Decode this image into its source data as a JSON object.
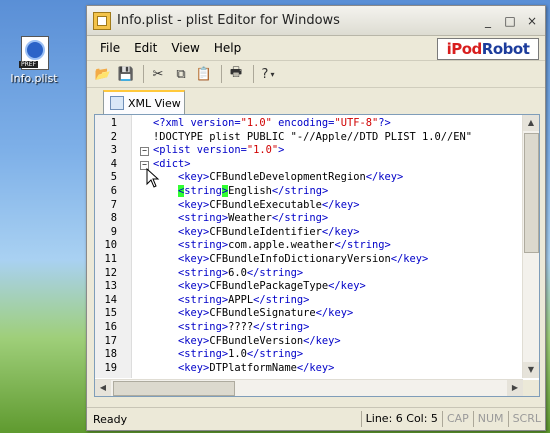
{
  "desktop": {
    "icon_label": "Info.plist",
    "icon_tag": "PREF"
  },
  "window": {
    "title": "Info.plist - plist Editor for Windows",
    "controls": {
      "minimize": "_",
      "maximize": "□",
      "close": "×"
    }
  },
  "menu": [
    "File",
    "Edit",
    "View",
    "Help"
  ],
  "logo": {
    "part1": "iPod",
    "part2": "Robot"
  },
  "toolbar_icons": [
    "open-icon",
    "save-icon",
    "cut-icon",
    "copy-icon",
    "paste-icon",
    "print-icon",
    "help-icon"
  ],
  "tab": {
    "label": "XML View"
  },
  "code_lines": [
    {
      "n": "1",
      "fold": "",
      "text": "<?xml version=\"1.0\" encoding=\"UTF-8\"?>"
    },
    {
      "n": "2",
      "fold": "",
      "text": "<!DOCTYPE plist PUBLIC \"-//Apple//DTD PLIST 1.0//EN\""
    },
    {
      "n": "3",
      "fold": "−",
      "text": "<plist version=\"1.0\">"
    },
    {
      "n": "4",
      "fold": "−",
      "text": "<dict>"
    },
    {
      "n": "5",
      "fold": "",
      "text": "    <key>CFBundleDevelopmentRegion</key>"
    },
    {
      "n": "6",
      "fold": "",
      "text": "    <string>English</string>"
    },
    {
      "n": "7",
      "fold": "",
      "text": "    <key>CFBundleExecutable</key>"
    },
    {
      "n": "8",
      "fold": "",
      "text": "    <string>Weather</string>"
    },
    {
      "n": "9",
      "fold": "",
      "text": "    <key>CFBundleIdentifier</key>"
    },
    {
      "n": "10",
      "fold": "",
      "text": "    <string>com.apple.weather</string>"
    },
    {
      "n": "11",
      "fold": "",
      "text": "    <key>CFBundleInfoDictionaryVersion</key>"
    },
    {
      "n": "12",
      "fold": "",
      "text": "    <string>6.0</string>"
    },
    {
      "n": "13",
      "fold": "",
      "text": "    <key>CFBundlePackageType</key>"
    },
    {
      "n": "14",
      "fold": "",
      "text": "    <string>APPL</string>"
    },
    {
      "n": "15",
      "fold": "",
      "text": "    <key>CFBundleSignature</key>"
    },
    {
      "n": "16",
      "fold": "",
      "text": "    <string>????</string>"
    },
    {
      "n": "17",
      "fold": "",
      "text": "    <key>CFBundleVersion</key>"
    },
    {
      "n": "18",
      "fold": "",
      "text": "    <string>1.0</string>"
    },
    {
      "n": "19",
      "fold": "",
      "text": "    <key>DTPlatformName</key>"
    }
  ],
  "status": {
    "ready": "Ready",
    "position": "Line: 6 Col: 5",
    "cap": "CAP",
    "num": "NUM",
    "scrl": "SCRL"
  },
  "colors": {
    "tag": "#0000c8",
    "attr_value": "#d00000",
    "match_highlight": "#32ff32"
  }
}
